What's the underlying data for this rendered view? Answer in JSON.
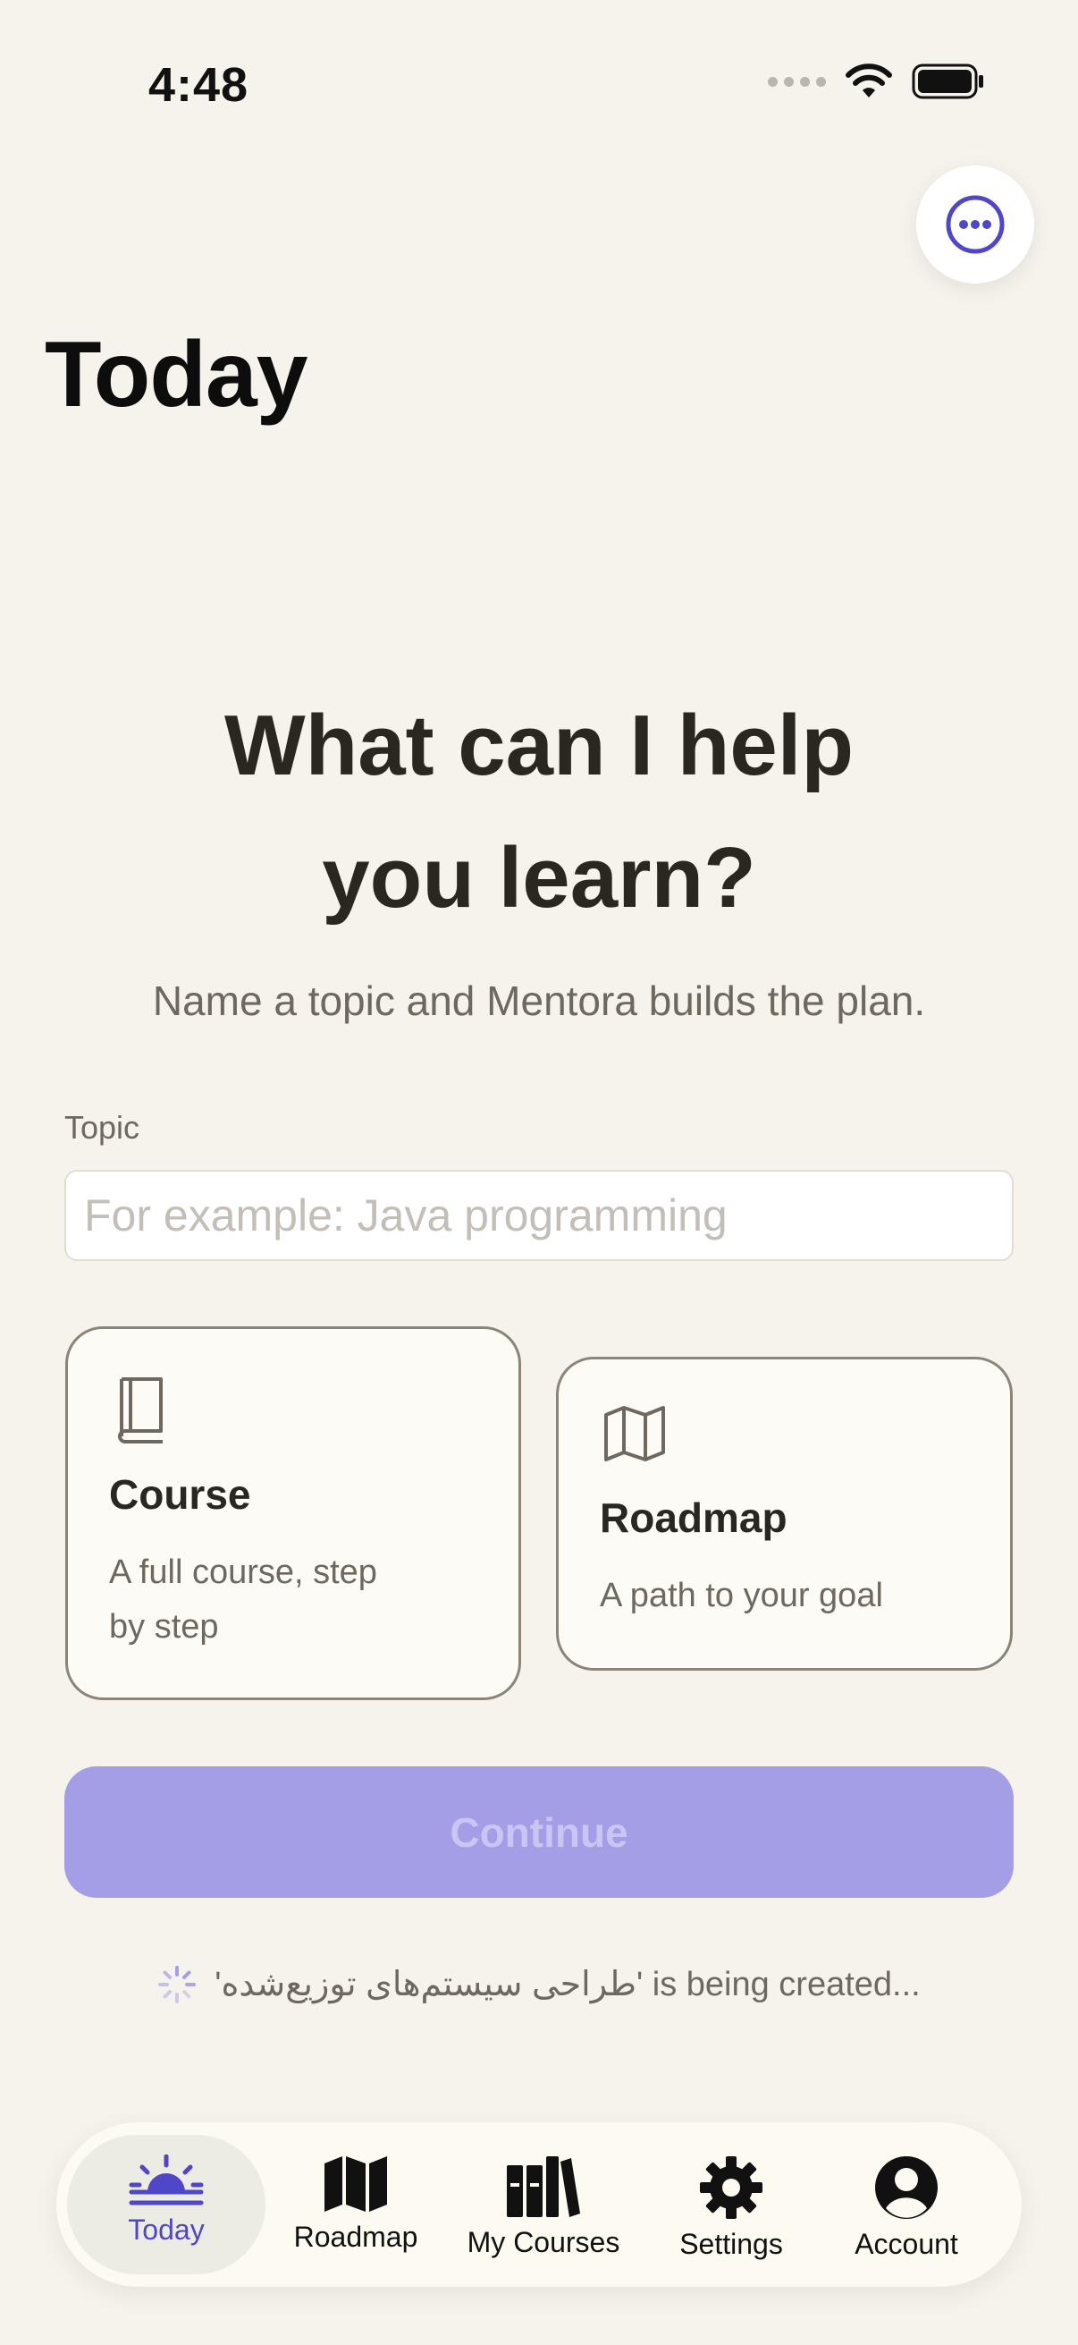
{
  "status_bar": {
    "time": "4:48"
  },
  "header": {
    "title": "Today",
    "more_icon": "ellipsis-circle-icon"
  },
  "hero": {
    "heading_line1": "What can I help",
    "heading_line2": "you learn?",
    "subtitle": "Name a topic and Mentora builds the plan."
  },
  "topic": {
    "label": "Topic",
    "value": "",
    "placeholder": "For example: Java programming"
  },
  "options": [
    {
      "title": "Course",
      "description_line1": "A full course, step",
      "description_line2": "by step",
      "icon": "book-icon",
      "selected": false
    },
    {
      "title": "Roadmap",
      "description": "A path to your goal",
      "icon": "map-icon",
      "selected": false
    }
  ],
  "continue_label": "Continue",
  "creating_status": {
    "text": "'طراحی سیستم‌های توزیع‌شده' is being created...",
    "icon": "spinner-icon"
  },
  "tabs": [
    {
      "label": "Today",
      "icon": "sunrise-icon",
      "active": true
    },
    {
      "label": "Roadmap",
      "icon": "map-fill-icon",
      "active": false
    },
    {
      "label": "My Courses",
      "icon": "books-icon",
      "active": false
    },
    {
      "label": "Settings",
      "icon": "gear-icon",
      "active": false
    },
    {
      "label": "Account",
      "icon": "person-circle-icon",
      "active": false
    }
  ],
  "colors": {
    "background": "#f6f3ec",
    "accent": "#4f46c8",
    "button_disabled": "#a39ee6",
    "card_border": "#8c8478"
  }
}
